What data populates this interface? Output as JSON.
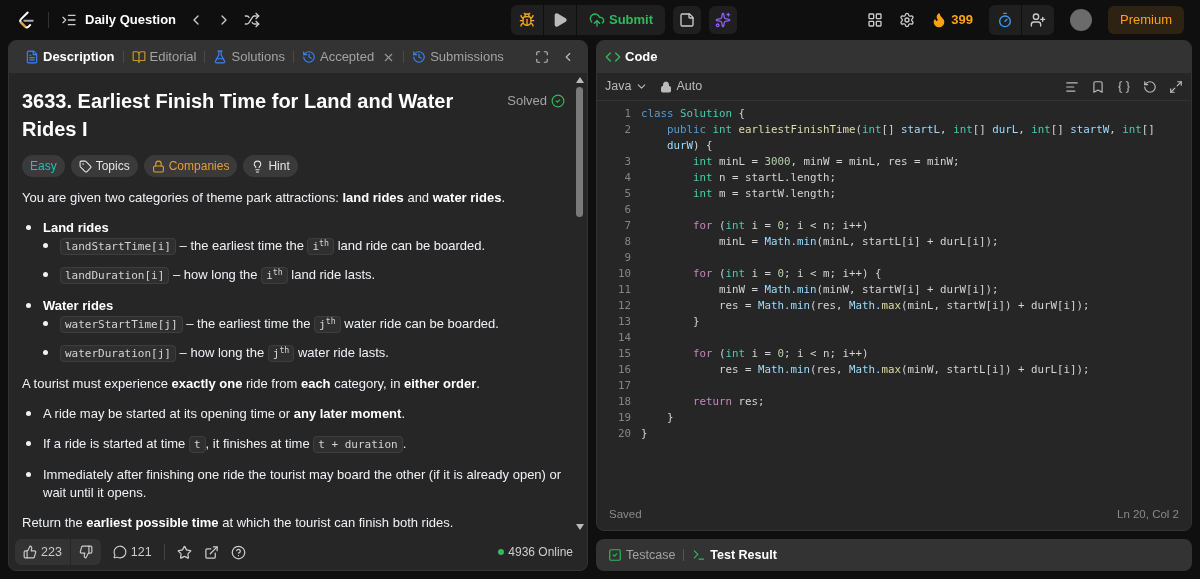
{
  "topbar": {
    "title": "Daily Question",
    "submit": "Submit",
    "streak": "399",
    "premium": "Premium"
  },
  "tabs": [
    {
      "label": "Description",
      "selected": true,
      "closable": false
    },
    {
      "label": "Editorial",
      "selected": false,
      "closable": false
    },
    {
      "label": "Solutions",
      "selected": false,
      "closable": false
    },
    {
      "label": "Accepted",
      "selected": false,
      "closable": true
    },
    {
      "label": "Submissions",
      "selected": false,
      "closable": false
    }
  ],
  "problem": {
    "title": "3633. Earliest Finish Time for Land and Water Rides I",
    "status": "Solved",
    "tags": [
      {
        "label": "Easy",
        "kind": "difficulty"
      },
      {
        "label": "Topics",
        "kind": "topics"
      },
      {
        "label": "Companies",
        "kind": "companies"
      },
      {
        "label": "Hint",
        "kind": "hint"
      }
    ],
    "blocks": [
      {
        "kind": "paragraph",
        "segments": [
          {
            "kind": "text",
            "s": "You are given two categories of theme park attractions: **land rides** and **water rides**."
          }
        ]
      },
      {
        "kind": "bullets",
        "items": [
          {
            "heading": "Land rides",
            "children": [
              {
                "segments": [
                  {
                    "kind": "code",
                    "s": "landStartTime[i]"
                  },
                  {
                    "kind": "text",
                    "s": " – the earliest time the "
                  },
                  {
                    "kind": "code",
                    "s": "i$^{th}$"
                  },
                  {
                    "kind": "text",
                    "s": " land ride can be boarded."
                  }
                ]
              },
              {
                "segments": [
                  {
                    "kind": "code",
                    "s": "landDuration[i]"
                  },
                  {
                    "kind": "text",
                    "s": " – how long the "
                  },
                  {
                    "kind": "code",
                    "s": "i$^{th}$"
                  },
                  {
                    "kind": "text",
                    "s": " land ride lasts."
                  }
                ]
              }
            ]
          },
          {
            "heading": "Water rides",
            "children": [
              {
                "segments": [
                  {
                    "kind": "code",
                    "s": "waterStartTime[j]"
                  },
                  {
                    "kind": "text",
                    "s": " – the earliest time the "
                  },
                  {
                    "kind": "code",
                    "s": "j$^{th}$"
                  },
                  {
                    "kind": "text",
                    "s": " water ride can be boarded."
                  }
                ]
              },
              {
                "segments": [
                  {
                    "kind": "code",
                    "s": "waterDuration[j]"
                  },
                  {
                    "kind": "text",
                    "s": " – how long the "
                  },
                  {
                    "kind": "code",
                    "s": "j$^{th}$"
                  },
                  {
                    "kind": "text",
                    "s": " water ride lasts."
                  }
                ]
              }
            ]
          }
        ]
      },
      {
        "kind": "paragraph",
        "segments": [
          {
            "kind": "text",
            "s": "A tourist must experience **exactly one** ride from **each** category, in **either order**."
          }
        ]
      },
      {
        "kind": "bullets",
        "items": [
          {
            "segments": [
              {
                "kind": "text",
                "s": "A ride may be started at its opening time or **any later moment**."
              }
            ]
          },
          {
            "segments": [
              {
                "kind": "text",
                "s": "If a ride is started at time "
              },
              {
                "kind": "code",
                "s": "t"
              },
              {
                "kind": "text",
                "s": ", it finishes at time "
              },
              {
                "kind": "code",
                "s": "t + duration"
              },
              {
                "kind": "text",
                "s": "."
              }
            ]
          },
          {
            "segments": [
              {
                "kind": "text",
                "s": "Immediately after finishing one ride the tourist may board the other (if it is already open) or wait until it opens."
              }
            ]
          }
        ]
      },
      {
        "kind": "paragraph",
        "segments": [
          {
            "kind": "text",
            "s": "Return the **earliest possible time** at which the tourist can finish both rides."
          }
        ]
      }
    ]
  },
  "footer": {
    "likes": "223",
    "comments": "121",
    "online": "4936 Online"
  },
  "editor": {
    "title": "Code",
    "language": "Java",
    "mode": "Auto",
    "status": "Saved",
    "cursor": "Ln 20, Col 2",
    "lines": [
      {
        "number": "1",
        "tokens": [
          {
            "text": "class ",
            "kind": "kw"
          },
          {
            "text": "Solution",
            "kind": "cls"
          },
          {
            "text": " {",
            "kind": "p"
          }
        ]
      },
      {
        "number": "2",
        "tokens": [
          {
            "text": "    public ",
            "kind": "kw"
          },
          {
            "text": "int ",
            "kind": "type"
          },
          {
            "text": "earliestFinishTime",
            "kind": "fn"
          },
          {
            "text": "(",
            "kind": "p"
          },
          {
            "text": "int",
            "kind": "type"
          },
          {
            "text": "[] ",
            "kind": "p"
          },
          {
            "text": "startL",
            "kind": "param"
          },
          {
            "text": ", ",
            "kind": "p"
          },
          {
            "text": "int",
            "kind": "type"
          },
          {
            "text": "[] ",
            "kind": "p"
          },
          {
            "text": "durL",
            "kind": "param"
          },
          {
            "text": ", ",
            "kind": "p"
          },
          {
            "text": "int",
            "kind": "type"
          },
          {
            "text": "[] ",
            "kind": "p"
          },
          {
            "text": "startW",
            "kind": "param"
          },
          {
            "text": ", ",
            "kind": "p"
          },
          {
            "text": "int",
            "kind": "type"
          },
          {
            "text": "[]",
            "kind": "p"
          }
        ],
        "continuation": [
          {
            "text": "    durW",
            "kind": "param"
          },
          {
            "text": ") {",
            "kind": "p"
          }
        ]
      },
      {
        "number": "3",
        "tokens": [
          {
            "text": "        int",
            "kind": "type"
          },
          {
            "text": " minL = ",
            "kind": "p"
          },
          {
            "text": "3000",
            "kind": "num"
          },
          {
            "text": ", minW = minL, res = minW;",
            "kind": "p"
          }
        ]
      },
      {
        "number": "4",
        "tokens": [
          {
            "text": "        int",
            "kind": "type"
          },
          {
            "text": " n = startL.length;",
            "kind": "p"
          }
        ]
      },
      {
        "number": "5",
        "tokens": [
          {
            "text": "        int",
            "kind": "type"
          },
          {
            "text": " m = startW.length;",
            "kind": "p"
          }
        ]
      },
      {
        "number": "6"
      },
      {
        "number": "7",
        "tokens": [
          {
            "text": "        for",
            "kind": "ctl"
          },
          {
            "text": " (",
            "kind": "p"
          },
          {
            "text": "int",
            "kind": "type"
          },
          {
            "text": " i = ",
            "kind": "p"
          },
          {
            "text": "0",
            "kind": "num"
          },
          {
            "text": "; i < n; i++)",
            "kind": "p"
          }
        ]
      },
      {
        "number": "8",
        "tokens": [
          {
            "text": "            minL = ",
            "kind": "p"
          },
          {
            "text": "Math.min",
            "kind": "obj"
          },
          {
            "text": "(minL, startL[i] + durL[i]);",
            "kind": "p"
          }
        ]
      },
      {
        "number": "9"
      },
      {
        "number": "10",
        "tokens": [
          {
            "text": "        for",
            "kind": "ctl"
          },
          {
            "text": " (",
            "kind": "p"
          },
          {
            "text": "int",
            "kind": "type"
          },
          {
            "text": " i = ",
            "kind": "p"
          },
          {
            "text": "0",
            "kind": "num"
          },
          {
            "text": "; i < m; i++) {",
            "kind": "p"
          }
        ]
      },
      {
        "number": "11",
        "tokens": [
          {
            "text": "            minW = ",
            "kind": "p"
          },
          {
            "text": "Math.min",
            "kind": "obj"
          },
          {
            "text": "(minW, startW[i] + durW[i]);",
            "kind": "p"
          }
        ]
      },
      {
        "number": "12",
        "tokens": [
          {
            "text": "            res = ",
            "kind": "p"
          },
          {
            "text": "Math.min",
            "kind": "obj"
          },
          {
            "text": "(res, ",
            "kind": "p"
          },
          {
            "text": "Math.",
            "kind": "obj"
          },
          {
            "text": "max",
            "kind": "fn"
          },
          {
            "text": "(minL, startW[i]) + durW[i]);",
            "kind": "p"
          }
        ]
      },
      {
        "number": "13",
        "tokens": [
          {
            "text": "        }",
            "kind": "p"
          }
        ]
      },
      {
        "number": "14"
      },
      {
        "number": "15",
        "tokens": [
          {
            "text": "        for",
            "kind": "ctl"
          },
          {
            "text": " (",
            "kind": "p"
          },
          {
            "text": "int",
            "kind": "type"
          },
          {
            "text": " i = ",
            "kind": "p"
          },
          {
            "text": "0",
            "kind": "num"
          },
          {
            "text": "; i < n; i++)",
            "kind": "p"
          }
        ]
      },
      {
        "number": "16",
        "tokens": [
          {
            "text": "            res = ",
            "kind": "p"
          },
          {
            "text": "Math.min",
            "kind": "obj"
          },
          {
            "text": "(res, ",
            "kind": "p"
          },
          {
            "text": "Math.",
            "kind": "obj"
          },
          {
            "text": "max",
            "kind": "fn"
          },
          {
            "text": "(minW, startL[i]) + durL[i]);",
            "kind": "p"
          }
        ]
      },
      {
        "number": "17"
      },
      {
        "number": "18",
        "tokens": [
          {
            "text": "        return",
            "kind": "ctl"
          },
          {
            "text": " res;",
            "kind": "p"
          }
        ]
      },
      {
        "number": "19",
        "tokens": [
          {
            "text": "    }",
            "kind": "p"
          }
        ]
      },
      {
        "number": "20",
        "tokens": [
          {
            "text": "}",
            "kind": "p"
          }
        ]
      }
    ]
  },
  "bottom_tabs": [
    {
      "label": "Testcase",
      "selected": false
    },
    {
      "label": "Test Result",
      "selected": true
    }
  ]
}
